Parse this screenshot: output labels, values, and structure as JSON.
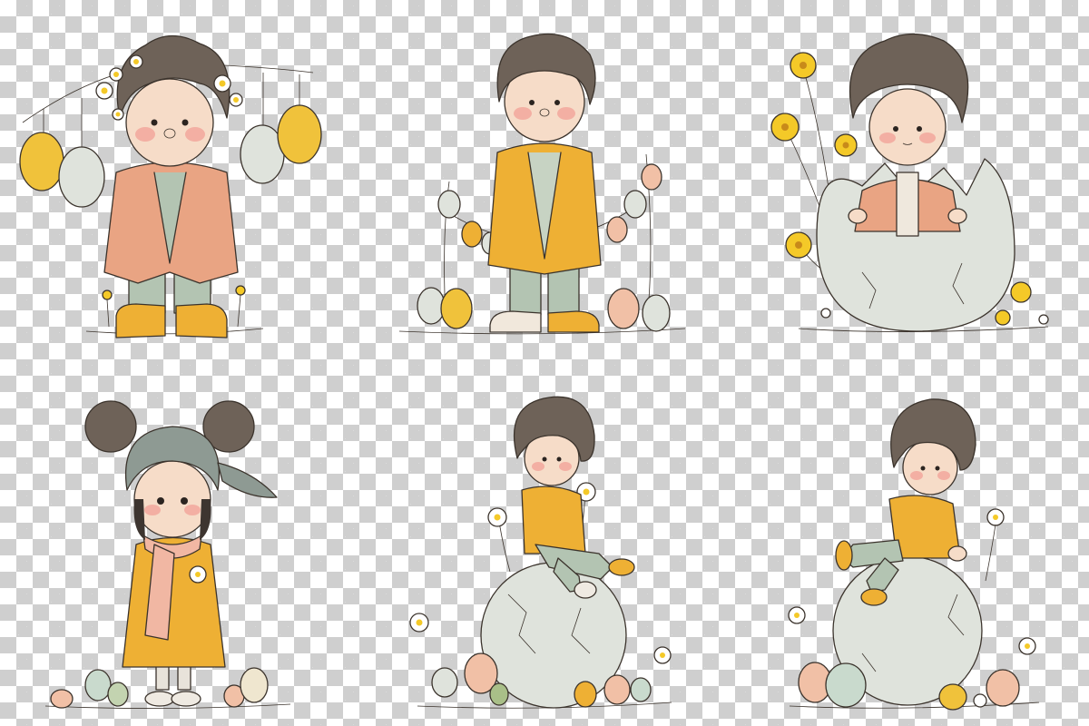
{
  "background": {
    "pattern": "transparency-checkerboard",
    "light": "#ffffff",
    "dark": "#cfcfcf"
  },
  "colors": {
    "hair": "#6e6258",
    "skin": "#f6dcc8",
    "cheek": "#f2a49a",
    "peach_coat": "#e9a483",
    "mustard_coat": "#eeb034",
    "sage_pants": "#b3c4b2",
    "egg_shell": "#dfe3dc",
    "egg_yellow": "#f0c23b",
    "egg_peach": "#f1c0a6",
    "flower_yellow": "#f4c928",
    "outline": "#3b332c"
  },
  "illustrations": [
    {
      "subject": "child-with-flower-crown-and-hanging-eggs",
      "coat": "peach",
      "shoes": "yellow"
    },
    {
      "subject": "child-in-mustard-coat-with-egg-garland",
      "coat": "mustard",
      "shoes": "sneakers"
    },
    {
      "subject": "child-hatching-from-cracked-egg",
      "coat": "peach",
      "flowers": "yellow-buttercups"
    },
    {
      "subject": "girl-with-headscarf-and-scarf",
      "coat": "mustard",
      "eggs": "pastel"
    },
    {
      "subject": "curly-child-sitting-on-big-egg",
      "sweater": "mustard",
      "flowers": "daisies"
    },
    {
      "subject": "curly-child-perched-on-big-egg",
      "sweater": "mustard",
      "flowers": "daisies"
    }
  ]
}
